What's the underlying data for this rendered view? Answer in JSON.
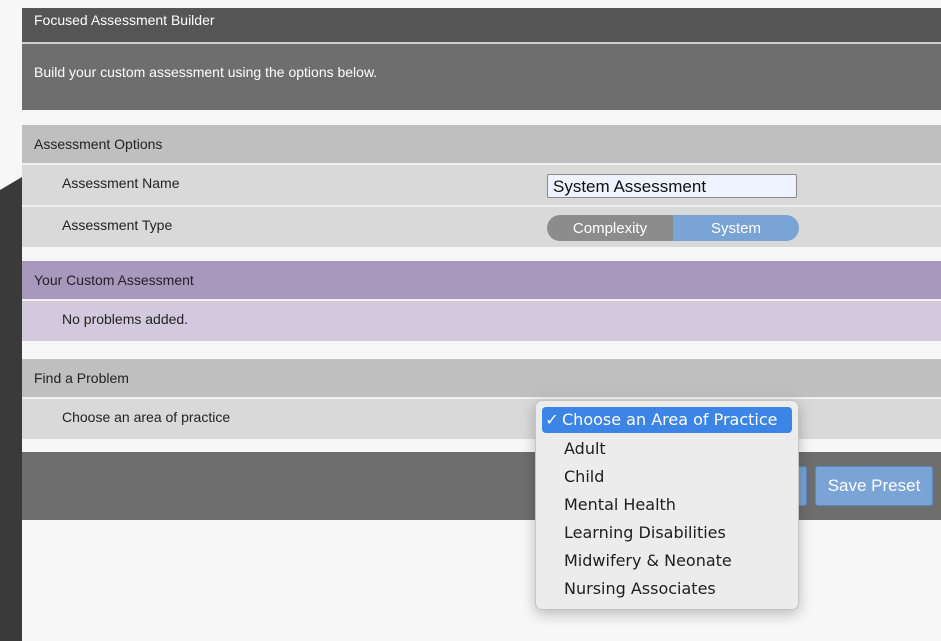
{
  "title": "Focused Assessment Builder",
  "intro": "Build your custom assessment using the options below.",
  "assessment_options": {
    "header": "Assessment Options",
    "name_label": "Assessment Name",
    "name_value": "System Assessment",
    "type_label": "Assessment Type",
    "type_options": [
      "Complexity",
      "System"
    ],
    "type_selected": "System"
  },
  "custom_assessment": {
    "header": "Your Custom Assessment",
    "empty_text": "No problems added."
  },
  "find_problem": {
    "header": "Find a Problem",
    "area_label": "Choose an area of practice",
    "menu": {
      "checkmark": "✓",
      "selected": "Choose an Area of Practice",
      "items": [
        "Choose an Area of Practice",
        "Adult",
        "Child",
        "Mental Health",
        "Learning Disabilities",
        "Midwifery & Neonate",
        "Nursing Associates"
      ]
    }
  },
  "footer": {
    "save_preset_label": "Save Preset"
  },
  "colors": {
    "accent_blue": "#7aa3d6",
    "menu_highlight": "#3c84e6",
    "purple_header": "#a898bd",
    "dark_header": "#555555"
  }
}
